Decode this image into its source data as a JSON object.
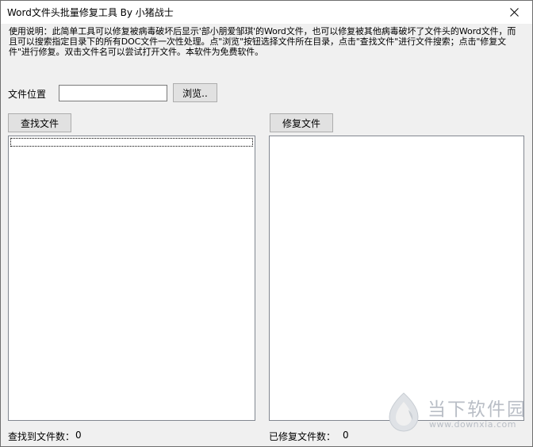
{
  "window": {
    "title": "Word文件头批量修复工具  By 小猪战士",
    "close_icon": "close-icon"
  },
  "description": "使用说明：此简单工具可以修复被病毒破坏后显示'部小朋爱邹琪'的Word文件，也可以修复被其他病毒破坏了文件头的Word文件，而且可以搜索指定目录下的所有DOC文件一次性处理。点\"浏览\"按钮选择文件所在目录，点击\"查找文件\"进行文件搜索；点击\"修复文件\"进行修复。双击文件名可以尝试打开文件。本软件为免费软件。",
  "location": {
    "label": "文件位置",
    "value": "",
    "browse_label": "浏览.."
  },
  "buttons": {
    "find_label": "查找文件",
    "repair_label": "修复文件"
  },
  "status": {
    "found_label": "查找到文件数：",
    "found_count": "0",
    "repaired_label": "已修复文件数：",
    "repaired_count": "0"
  },
  "watermark": {
    "title": "当下软件园",
    "url": "www.downxia.com",
    "logo_icon": "downxia-logo-icon"
  }
}
